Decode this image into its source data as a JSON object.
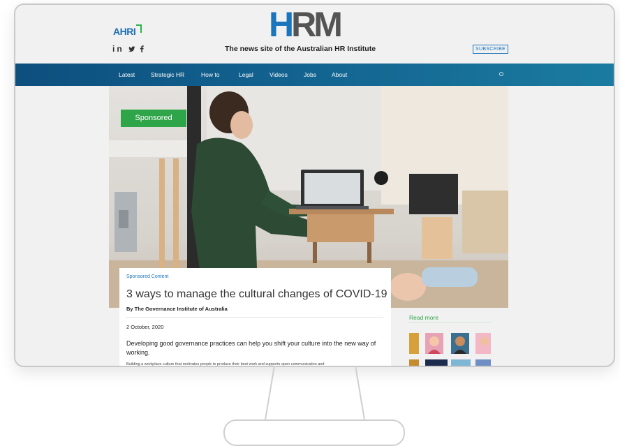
{
  "header": {
    "ahri_logo": "AHRI",
    "social_icons": [
      "linkedin-icon",
      "twitter-icon",
      "facebook-icon"
    ],
    "social_text": "in",
    "logo_h": "H",
    "logo_rm": "RM",
    "tagline": "The news site of the Australian HR Institute",
    "subscribe_label": "SUBSCRIBE"
  },
  "nav": {
    "items": [
      "Latest",
      "Strategic HR",
      "How to",
      "Legal",
      "Videos",
      "Jobs",
      "About"
    ],
    "search_icon": "search-icon"
  },
  "hero": {
    "badge": "Sponsored"
  },
  "article": {
    "kicker": "Sponsored Content",
    "title": "3 ways to manage the cultural changes of COVID-19",
    "byline": "By The Governance Institute of Australia",
    "date": "2 October, 2020",
    "lead": "Developing good governance practices can help you shift your culture into the new way of working.",
    "body": "Building a workplace culture that motivates people to produce their best work and supports open communication and"
  },
  "sidebar": {
    "read_more": "Read more"
  },
  "colors": {
    "brand_blue": "#1b75bc",
    "brand_grey": "#545454",
    "nav_start": "#0d4f7e",
    "nav_end": "#1b7ba0",
    "sponsored_green": "#2fa54a"
  }
}
